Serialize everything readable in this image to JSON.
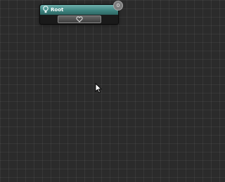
{
  "graph": {
    "root_node": {
      "title": "Root",
      "badge": "0",
      "header_color": "#4a918d",
      "icon": "bulb-icon",
      "port_icon": "heart-icon"
    }
  },
  "canvas": {
    "background_color": "#2b2b2b",
    "grid": true
  },
  "cursor": {
    "icon": "arrow-cursor-icon"
  }
}
